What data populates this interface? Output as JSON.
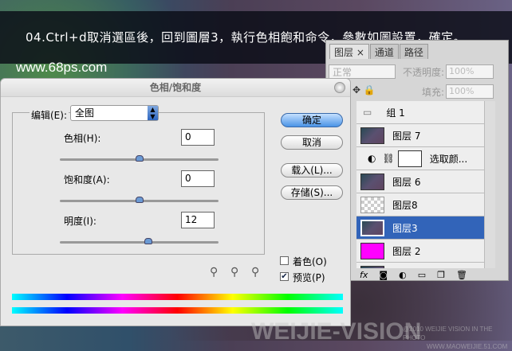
{
  "banner": {
    "text": "04.Ctrl+d取消選區後，回到圖層3，執行色相飽和命令，參數如圖設置，確定。",
    "site": "www.68ps.com"
  },
  "watermark": {
    "logo": "WEIJIE-VISION",
    "line1": "@2010 WEIJIE VISION IN THE PHOTO",
    "line2": "WWW.MAOWEIJIE.51.COM"
  },
  "layers_panel": {
    "tabs": [
      {
        "label": "图层 ×",
        "active": true
      },
      {
        "label": "通道"
      },
      {
        "label": "路径"
      }
    ],
    "blend_mode": "正常",
    "opacity_label": "不透明度:",
    "opacity": "100%",
    "fill_label": "填充:",
    "fill": "100%",
    "layers": [
      {
        "name": "组 1",
        "type": "group"
      },
      {
        "name": "图层 7",
        "type": "layer"
      },
      {
        "name": "选取颜...",
        "type": "adjustment"
      },
      {
        "name": "图层 6",
        "type": "layer"
      },
      {
        "name": "图层8",
        "type": "transparent"
      },
      {
        "name": "图层3",
        "type": "layer",
        "selected": true
      },
      {
        "name": "图层 2",
        "type": "fill",
        "color": "#ff00ff"
      }
    ],
    "bottom_icons": [
      "fx",
      "mask",
      "adjustment",
      "folder",
      "new-layer",
      "trash"
    ]
  },
  "dialog": {
    "title": "色相/饱和度",
    "edit_label": "编辑(E):",
    "edit_value": "全图",
    "hue_label": "色相(H):",
    "hue": "0",
    "saturation_label": "饱和度(A):",
    "saturation": "0",
    "lightness_label": "明度(I):",
    "lightness": "12",
    "buttons": {
      "ok": "确定",
      "cancel": "取消",
      "load": "载入(L)...",
      "save": "存储(S)..."
    },
    "colorize_label": "着色(O)",
    "colorize": false,
    "preview_label": "预览(P)",
    "preview": true
  }
}
